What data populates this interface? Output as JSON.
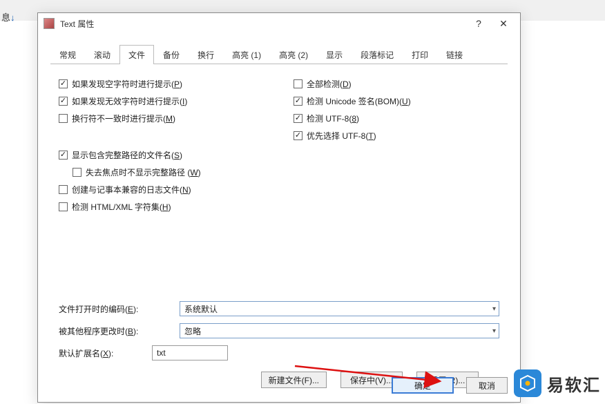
{
  "bg": {
    "text": "息",
    "arrow": "↓"
  },
  "titlebar": {
    "title": "Text 属性"
  },
  "tabs": [
    "常规",
    "滚动",
    "文件",
    "备份",
    "换行",
    "高亮 (1)",
    "高亮 (2)",
    "显示",
    "段落标记",
    "打印",
    "链接"
  ],
  "activeTab": 2,
  "left_checks": [
    {
      "checked": true,
      "label": "如果发现空字符时进行提示(",
      "mnemonic": "P",
      "tail": ")",
      "indent": false
    },
    {
      "checked": true,
      "label": "如果发现无效字符时进行提示(",
      "mnemonic": "I",
      "tail": ")",
      "indent": false
    },
    {
      "checked": false,
      "label": "换行符不一致时进行提示(",
      "mnemonic": "M",
      "tail": ")",
      "indent": false
    }
  ],
  "left_checks2": [
    {
      "checked": true,
      "label": "显示包含完整路径的文件名(",
      "mnemonic": "S",
      "tail": ")",
      "indent": false
    },
    {
      "checked": false,
      "label": "失去焦点时不显示完整路径 (",
      "mnemonic": "W",
      "tail": ")",
      "indent": true
    },
    {
      "checked": false,
      "label": "创建与记事本兼容的日志文件(",
      "mnemonic": "N",
      "tail": ")",
      "indent": false
    },
    {
      "checked": false,
      "label": "检测 HTML/XML 字符集(",
      "mnemonic": "H",
      "tail": ")",
      "indent": false
    }
  ],
  "right_checks": [
    {
      "checked": false,
      "label": "全部检测(",
      "mnemonic": "D",
      "tail": ")"
    },
    {
      "checked": true,
      "label": "检测 Unicode 签名(BOM)(",
      "mnemonic": "U",
      "tail": ")"
    },
    {
      "checked": true,
      "label": "检测 UTF-8(",
      "mnemonic": "8",
      "tail": ")"
    },
    {
      "checked": true,
      "label": "优先选择 UTF-8(",
      "mnemonic": "T",
      "tail": ")"
    }
  ],
  "form": {
    "encoding_label": "文件打开时的编码(",
    "encoding_mnemonic": "E",
    "encoding_tail": "):",
    "encoding_value": "系统默认",
    "changed_label": "被其他程序更改时(",
    "changed_mnemonic": "B",
    "changed_tail": "):",
    "changed_value": "忽略",
    "ext_label": "默认扩展名(",
    "ext_mnemonic": "X",
    "ext_tail": "):",
    "ext_value": "txt"
  },
  "buttons": {
    "newfile": "新建文件(F)...",
    "saving": "保存中(V)...",
    "reset": "重置(R)...",
    "ok": "确定",
    "cancel": "取消"
  },
  "watermark": {
    "text": "易软汇"
  }
}
